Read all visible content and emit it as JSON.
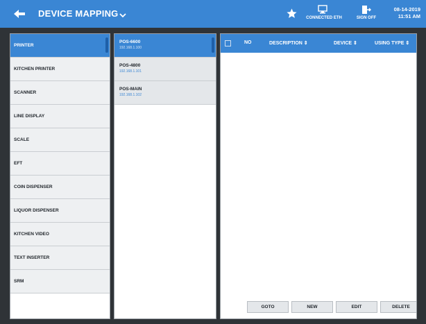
{
  "header": {
    "title": "DEVICE MAPPING",
    "connection_label": "CONNECTED ETH",
    "signoff_label": "SIGN OFF",
    "date": "08-14-2019",
    "time": "11:51 AM"
  },
  "device_types": [
    {
      "label": "PRINTER",
      "selected": true
    },
    {
      "label": "KITCHEN PRINTER",
      "selected": false
    },
    {
      "label": "SCANNER",
      "selected": false
    },
    {
      "label": "LINE DISPLAY",
      "selected": false
    },
    {
      "label": "SCALE",
      "selected": false
    },
    {
      "label": "EFT",
      "selected": false
    },
    {
      "label": "COIN DISPENSER",
      "selected": false
    },
    {
      "label": "LIQUOR DISPENSER",
      "selected": false
    },
    {
      "label": "KITCHEN VIDEO",
      "selected": false
    },
    {
      "label": "TEXT INSERTER",
      "selected": false
    },
    {
      "label": "SRM",
      "selected": false
    }
  ],
  "pos_stations": [
    {
      "name": "POS-6600",
      "ip": "192.168.1.100",
      "selected": true
    },
    {
      "name": "POS-4800",
      "ip": "192.168.1.101",
      "selected": false
    },
    {
      "name": "POS-MAIN",
      "ip": "192.168.1.102",
      "selected": false
    }
  ],
  "table": {
    "col_no": "NO",
    "col_description": "DESCRIPTION ⇕",
    "col_device": "DEVICE ⇕",
    "col_using_type": "USING TYPE ⇕",
    "rows": []
  },
  "buttons": {
    "goto": "GOTO",
    "new": "NEW",
    "edit": "EDIT",
    "delete": "DELETE"
  },
  "colors": {
    "accent": "#3a86d4",
    "background": "#2f3337"
  }
}
